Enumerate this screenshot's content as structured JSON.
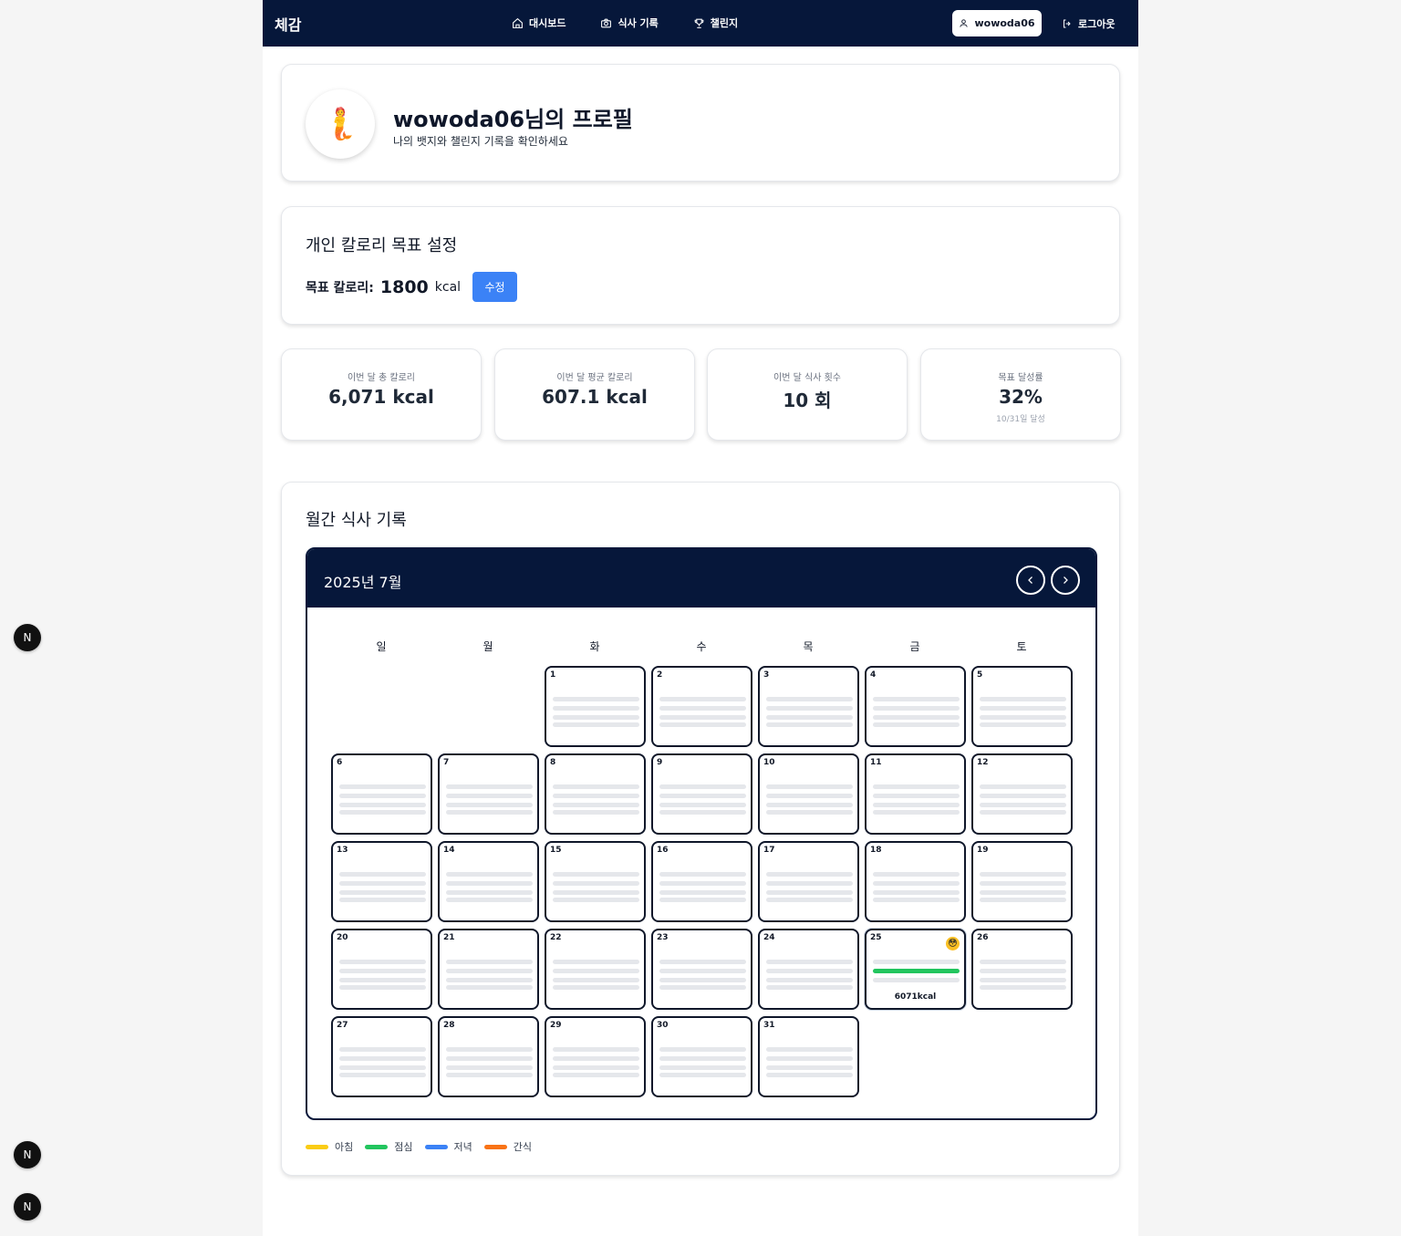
{
  "nav": {
    "brand": "체감",
    "links": [
      {
        "label": "대시보드",
        "icon": "home-icon"
      },
      {
        "label": "식사 기록",
        "icon": "camera-icon"
      },
      {
        "label": "챌린지",
        "icon": "trophy-icon"
      }
    ],
    "user": "wowoda06",
    "logout": "로그아웃"
  },
  "profile": {
    "title": "wowoda06님의 프로필",
    "subtitle": "나의 뱃지와 챌린지 기록을 확인하세요",
    "avatar": "🧜"
  },
  "goal": {
    "heading": "개인 칼로리 목표 설정",
    "label": "목표 칼로리:",
    "value": "1800",
    "unit": "kcal",
    "edit_label": "수정"
  },
  "stats": [
    {
      "label": "이번 달 총 칼로리",
      "value": "6,071 kcal",
      "note": ""
    },
    {
      "label": "이번 달 평균 칼로리",
      "value": "607.1 kcal",
      "note": ""
    },
    {
      "label": "이번 달 식사 횟수",
      "value": "10 회",
      "note": ""
    },
    {
      "label": "목표 달성률",
      "value": "32%",
      "note": "10/31일 달성"
    }
  ],
  "calendar": {
    "heading": "월간 식사 기록",
    "month": "2025년 7월",
    "weekdays": [
      "일",
      "월",
      "화",
      "수",
      "목",
      "금",
      "토"
    ],
    "first_weekday": 2,
    "days_in_month": 31,
    "highlight": {
      "day": 25,
      "kcal": "6071kcal",
      "emoji": "😳",
      "meal_color": "#22c55e"
    }
  },
  "legend": [
    {
      "label": "아침",
      "color": "#facc15"
    },
    {
      "label": "점심",
      "color": "#22c55e"
    },
    {
      "label": "저녁",
      "color": "#3b82f6"
    },
    {
      "label": "간식",
      "color": "#f97316"
    }
  ],
  "badges": [
    "N",
    "N",
    "N"
  ]
}
